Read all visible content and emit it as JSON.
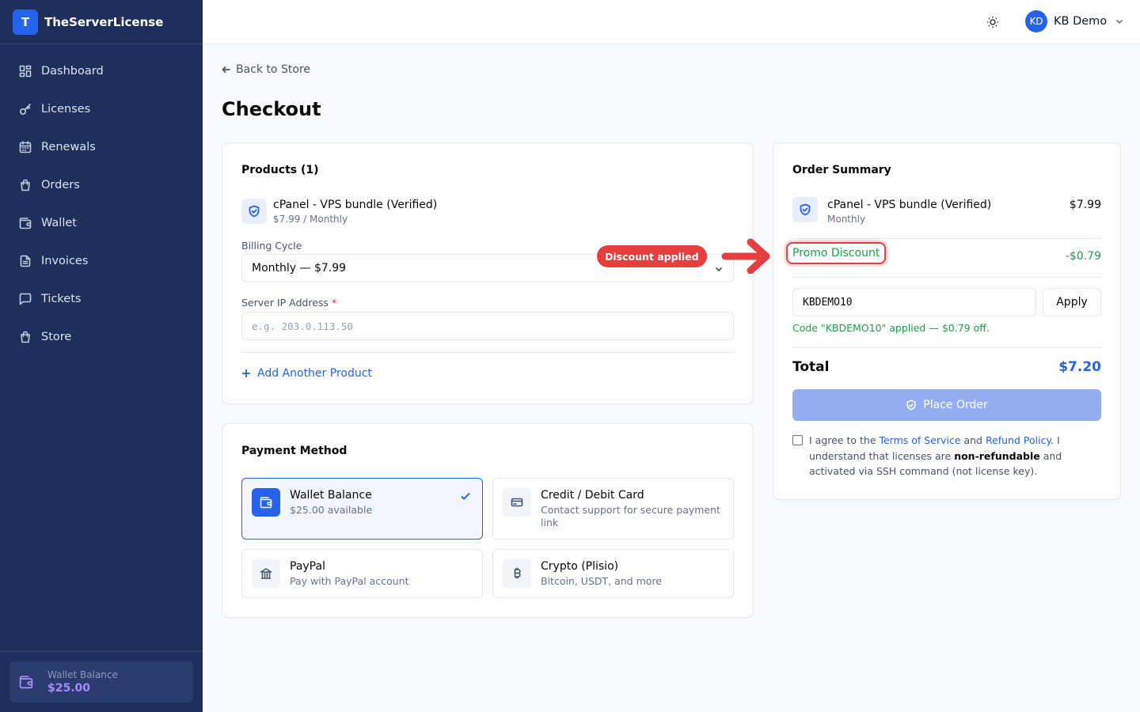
{
  "brand": {
    "logo_letter": "T",
    "name": "TheServerLicense"
  },
  "sidebar": {
    "items": [
      {
        "label": "Dashboard",
        "icon": "dashboard-icon"
      },
      {
        "label": "Licenses",
        "icon": "key-icon"
      },
      {
        "label": "Renewals",
        "icon": "calendar-icon"
      },
      {
        "label": "Orders",
        "icon": "shopping-bag-icon"
      },
      {
        "label": "Wallet",
        "icon": "wallet-icon"
      },
      {
        "label": "Invoices",
        "icon": "file-text-icon"
      },
      {
        "label": "Tickets",
        "icon": "message-square-icon"
      },
      {
        "label": "Store",
        "icon": "shopping-bag-icon"
      }
    ],
    "wallet": {
      "label": "Wallet Balance",
      "amount": "$25.00"
    }
  },
  "topbar": {
    "user_initials": "KD",
    "user_name": "KB Demo",
    "theme_icon": "sun-icon"
  },
  "page": {
    "back_label": "Back to Store",
    "title": "Checkout"
  },
  "products": {
    "title": "Products (1)",
    "item": {
      "name": "cPanel - VPS bundle (Verified)",
      "price": "$7.99 / Monthly"
    },
    "billing_label": "Billing Cycle",
    "billing_value": "Monthly — $7.99",
    "ip_label": "Server IP Address",
    "ip_required": "*",
    "ip_placeholder": "e.g. 203.0.113.50",
    "add_label": "Add Another Product"
  },
  "annotation": {
    "badge": "Discount applied"
  },
  "payment": {
    "title": "Payment Method",
    "options": [
      {
        "title": "Wallet Balance",
        "desc": "$25.00 available",
        "icon": "wallet-icon",
        "selected": true
      },
      {
        "title": "Credit / Debit Card",
        "desc": "Contact support for secure payment link",
        "icon": "credit-card-icon",
        "selected": false
      },
      {
        "title": "PayPal",
        "desc": "Pay with PayPal account",
        "icon": "bank-icon",
        "selected": false
      },
      {
        "title": "Crypto (Plisio)",
        "desc": "Bitcoin, USDT, and more",
        "icon": "bitcoin-icon",
        "selected": false
      }
    ]
  },
  "summary": {
    "title": "Order Summary",
    "item": {
      "name": "cPanel - VPS bundle (Verified)",
      "cycle": "Monthly",
      "price": "$7.99"
    },
    "promo_label": "Promo Discount",
    "promo_value": "-$0.79",
    "code_value": "KBDEMO10",
    "apply_label": "Apply",
    "code_message": "Code \"KBDEMO10\" applied — $0.79 off.",
    "total_label": "Total",
    "total_value": "$7.20",
    "place_label": "Place Order",
    "agree": {
      "p1": "I agree to the ",
      "tos": "Terms of Service",
      "p2": " and ",
      "refund": "Refund Policy",
      "p3": ". I understand that licenses are ",
      "bold": "non-refundable",
      "p4": " and activated via SSH command (not license key)."
    }
  },
  "colors": {
    "sidebar": "#1e2f5c",
    "accent": "#2563eb",
    "success": "#16a34a",
    "annotation": "#e53e3e",
    "wallet_amount": "#a78bfa"
  }
}
